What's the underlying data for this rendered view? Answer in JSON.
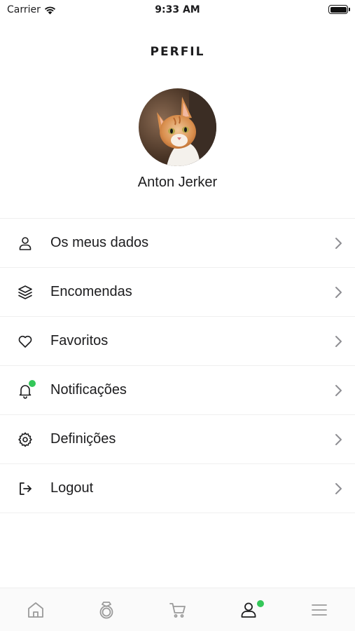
{
  "status_bar": {
    "carrier": "Carrier",
    "time": "9:33 AM"
  },
  "header": {
    "title": "PERFIL"
  },
  "profile": {
    "name": "Anton Jerker"
  },
  "menu": {
    "items": [
      {
        "label": "Os meus dados",
        "icon": "user-icon"
      },
      {
        "label": "Encomendas",
        "icon": "layers-icon"
      },
      {
        "label": "Favoritos",
        "icon": "heart-icon"
      },
      {
        "label": "Notificações",
        "icon": "bell-icon",
        "badge": true
      },
      {
        "label": "Definições",
        "icon": "gear-icon"
      },
      {
        "label": "Logout",
        "icon": "logout-icon"
      }
    ]
  },
  "tab_bar": {
    "tabs": [
      {
        "icon": "home-icon"
      },
      {
        "icon": "ring-icon"
      },
      {
        "icon": "cart-icon"
      },
      {
        "icon": "profile-icon",
        "active": true,
        "badge": true
      },
      {
        "icon": "hamburger-menu-icon"
      }
    ]
  },
  "colors": {
    "accent_dot": "#34c759",
    "text": "#1c1c1e",
    "icon_gray": "#9a9a9a",
    "divider": "#efefef"
  }
}
